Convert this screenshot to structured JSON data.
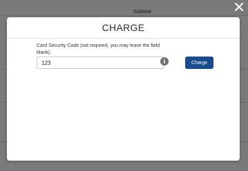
{
  "background": {
    "subtotal_label": "Subtotal"
  },
  "modal": {
    "title": "CHARGE",
    "close_icon": "close-icon",
    "field_label": "Card Security Code (not required, you may leave the field blank).",
    "csc_value": "123",
    "info_icon": "info-icon",
    "info_glyph": "i",
    "charge_button_label": "Charge"
  },
  "colors": {
    "primary_button": "#1a4b8c",
    "overlay": "rgba(0,0,0,0.5)"
  }
}
